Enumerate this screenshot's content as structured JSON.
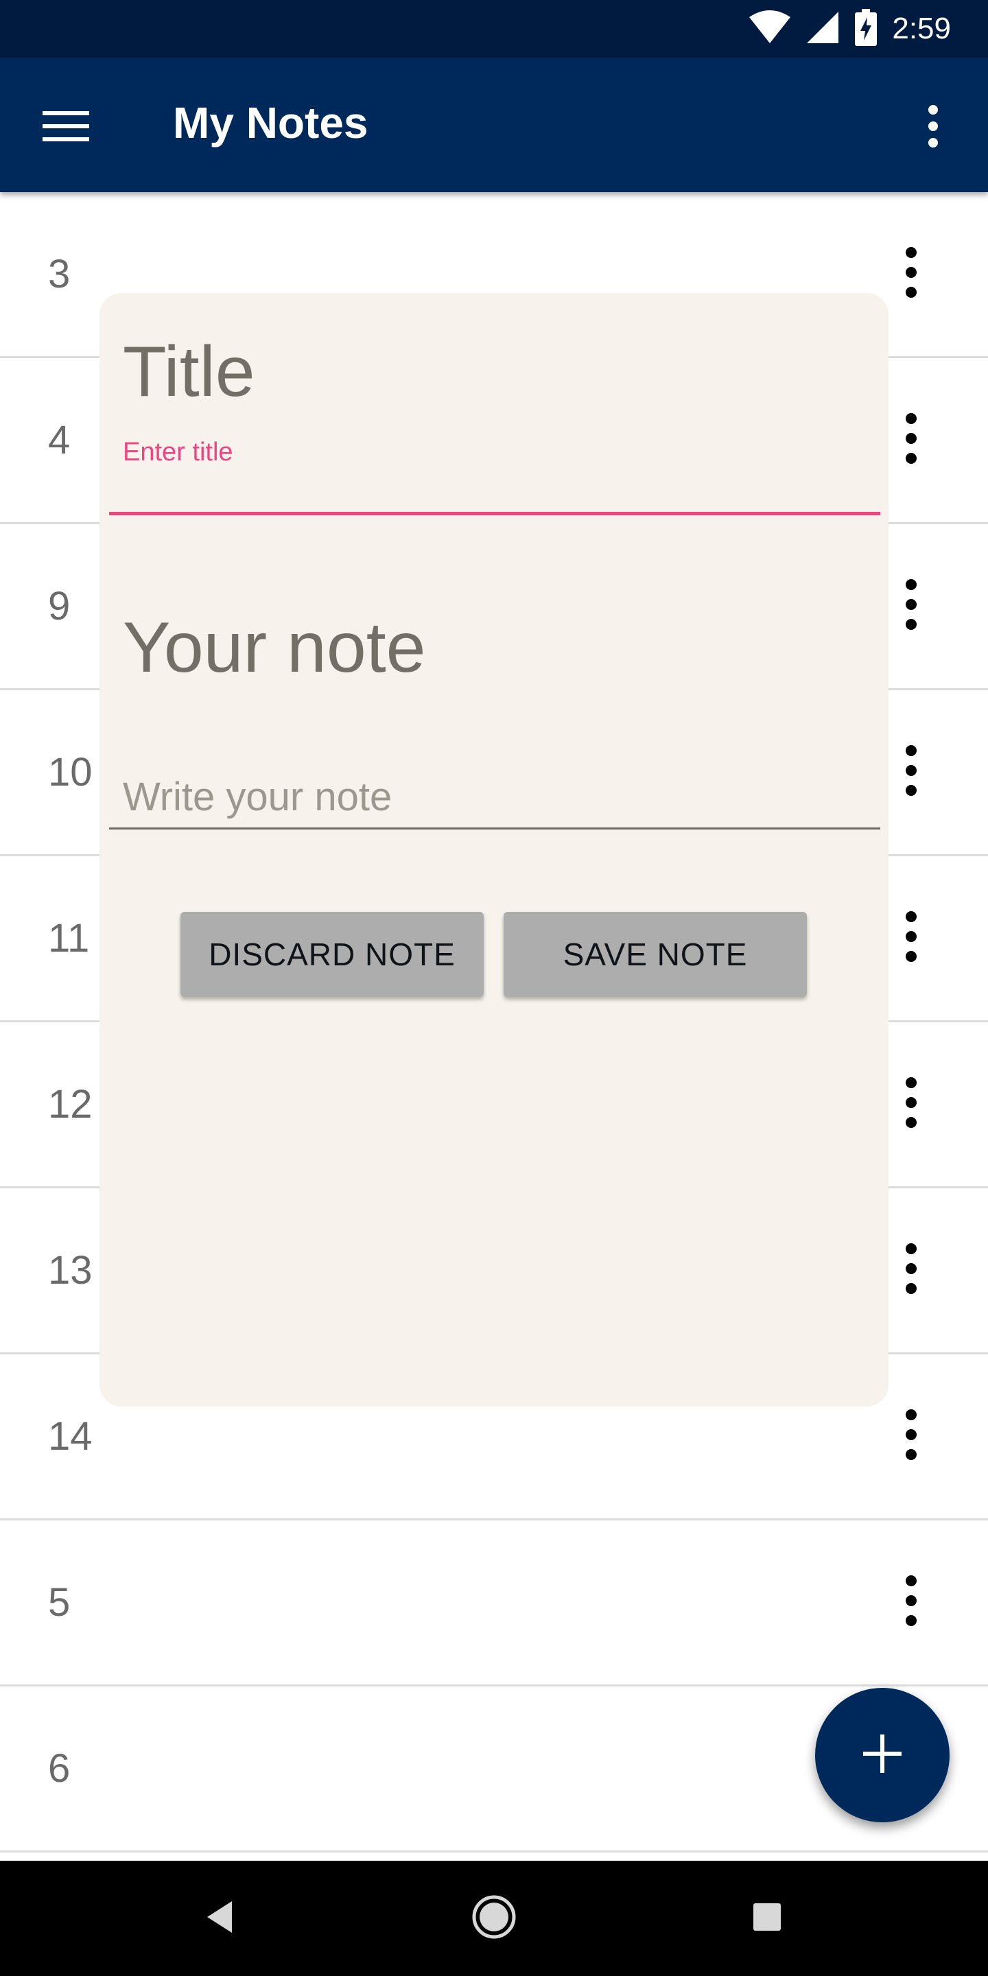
{
  "status_bar": {
    "time": "2:59",
    "icons": [
      "wifi-icon",
      "cell-signal-icon",
      "battery-charging-icon"
    ]
  },
  "app_bar": {
    "menu_icon": "menu-icon",
    "title": "My Notes",
    "overflow_icon": "more-vert-icon"
  },
  "notes": [
    {
      "number": "3"
    },
    {
      "number": "4"
    },
    {
      "number": "9"
    },
    {
      "number": "10"
    },
    {
      "number": "11"
    },
    {
      "number": "12"
    },
    {
      "number": "13"
    },
    {
      "number": "14"
    },
    {
      "number": "5"
    },
    {
      "number": "6"
    }
  ],
  "dialog": {
    "title_heading": "Title",
    "title_label": "Enter title",
    "title_value": "",
    "note_heading": "Your note",
    "note_value": "",
    "note_placeholder": "Write your note",
    "discard_label": "DISCARD NOTE",
    "save_label": "SAVE NOTE"
  },
  "fab": {
    "icon": "plus-icon"
  },
  "nav_bar": {
    "icons": [
      "back-icon",
      "home-icon",
      "recents-icon"
    ]
  },
  "colors": {
    "status_bar": "#001a40",
    "app_bar": "#00295b",
    "accent_pink": "#ee4581",
    "dialog_bg": "#f7f3ec",
    "button_grey": "#adadad",
    "fab": "#00295b"
  }
}
